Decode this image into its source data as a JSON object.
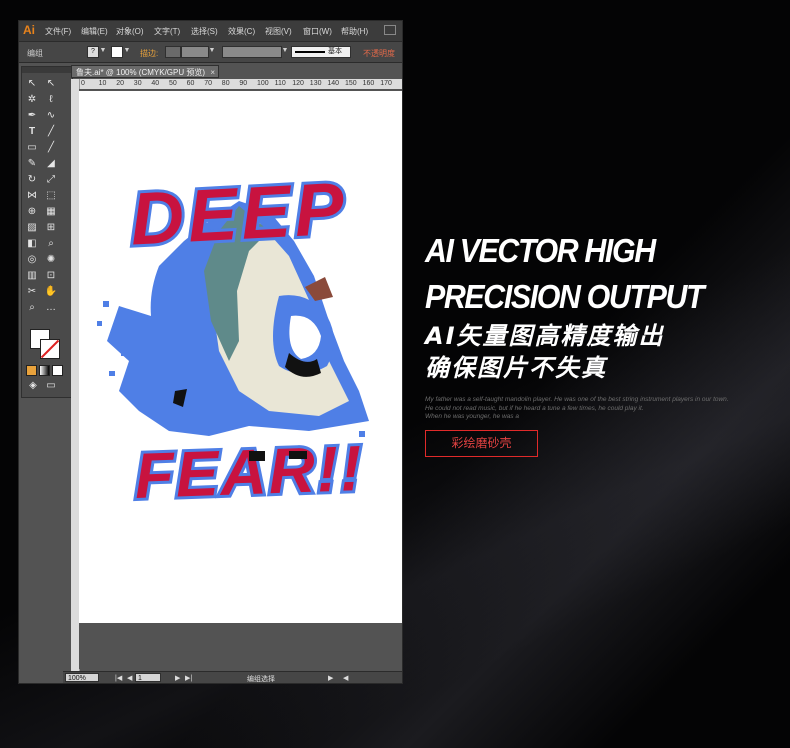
{
  "app": {
    "logo": "Ai",
    "menu": [
      "文件(F)",
      "编辑(E)",
      "对象(O)",
      "文字(T)",
      "选择(S)",
      "效果(C)",
      "视图(V)",
      "窗口(W)",
      "帮助(H)"
    ]
  },
  "control_bar": {
    "selection_label": "编组",
    "stroke_label": "描边:",
    "stroke_style": "基本",
    "opacity_label": "不透明度"
  },
  "document": {
    "tab_title": "鲁夫.ai* @ 100% (CMYK/GPU 预览)",
    "ruler_marks": [
      "0",
      "10",
      "20",
      "30",
      "40",
      "50",
      "60",
      "70",
      "80",
      "90",
      "100",
      "110",
      "120",
      "130",
      "140",
      "150",
      "160",
      "170"
    ],
    "artwork": {
      "top_text": "DEEP",
      "bottom_text": "FEAR!!",
      "colors": {
        "red": "#c8133f",
        "blue": "#4f7fe6",
        "teal": "#5f8a8a",
        "cream": "#e9e6d6",
        "brown": "#8a4a3a",
        "black": "#111111"
      }
    }
  },
  "status_bar": {
    "zoom": "100%",
    "artboard": "1",
    "tool_status": "编组选择"
  },
  "hero": {
    "line1": "AI VECTOR HIGH",
    "line2": "PRECISION OUTPUT",
    "line3": "AI矢量图高精度输出",
    "line4": "确保图片不失真",
    "body": [
      "My father was a self-taught mandolin player. He was one of the best string instrument players in our town.",
      "He could not read music, but if he heard a tune a few times, he could play it.",
      "When he was younger, he was a"
    ],
    "tag": "彩绘磨砂壳"
  },
  "colors": {
    "accent_red": "#e02a2a",
    "ai_orange": "#e8831c"
  }
}
